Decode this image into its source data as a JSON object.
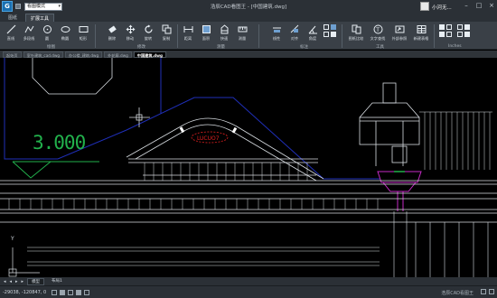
{
  "window": {
    "title": "浩辰CAD看图王 - [中国建筑.dwg]",
    "mode": "看图模式",
    "user_name": "小河无..."
  },
  "ribbon_tabs": [
    "图纸",
    "扩展工具"
  ],
  "ribbon": {
    "group1": {
      "label": "绘图",
      "tools": [
        {
          "label": "直线",
          "icon": "line-icon"
        },
        {
          "label": "多段线",
          "icon": "polyline-icon"
        },
        {
          "label": "圆",
          "icon": "circle-icon"
        },
        {
          "label": "椭圆",
          "icon": "ellipse-icon"
        },
        {
          "label": "矩形",
          "icon": "rectangle-icon"
        }
      ]
    },
    "group2": {
      "label": "修改",
      "tools": [
        {
          "label": "删除",
          "icon": "eraser-icon"
        },
        {
          "label": "移动",
          "icon": "move-icon"
        },
        {
          "label": "旋转",
          "icon": "rotate-icon"
        },
        {
          "label": "复制",
          "icon": "copy-icon"
        }
      ]
    },
    "group3": {
      "label": "测量",
      "tools": [
        {
          "label": "距离",
          "icon": "distance-icon"
        },
        {
          "label": "面积",
          "icon": "area-icon"
        },
        {
          "label": "快速",
          "icon": "quick-measure-icon"
        },
        {
          "label": "测量",
          "icon": "measure-icon"
        }
      ]
    },
    "group4": {
      "label": "标注",
      "tools": [
        {
          "label": "线性",
          "icon": "linear-dim-icon"
        },
        {
          "label": "对齐",
          "icon": "aligned-dim-icon"
        },
        {
          "label": "角度",
          "icon": "angle-dim-icon"
        }
      ]
    },
    "group5": {
      "label": "工具",
      "tools": [
        {
          "label": "图纸比较",
          "icon": "compare-icon"
        },
        {
          "label": "文字查找",
          "icon": "text-search-icon"
        },
        {
          "label": "外部参照",
          "icon": "xref-icon"
        },
        {
          "label": "新建表格",
          "icon": "table-icon"
        }
      ]
    },
    "group6": {
      "label": "Inches"
    }
  },
  "doc_tabs": [
    "起始页",
    "室外建筑_cad.dwg",
    "办公楼_建筑.dwg",
    "外轮廓.dwg",
    "中国建筑.dwg"
  ],
  "active_doc_tab": 4,
  "canvas": {
    "elevation_text": "3.000",
    "section_label": "LUCUO7",
    "axis_y": "Y"
  },
  "layout_tabs": [
    "模型",
    "布局1"
  ],
  "status": {
    "coords": "-29038, -120847, 0",
    "brand": "浩辰CAD看图王"
  },
  "colors": {
    "canvas": "#000000",
    "chrome": "#2b3036",
    "ribbon": "#3a4047",
    "line_white": "#d8dde2",
    "line_blue": "#1f2fb8",
    "line_green": "#22b14c",
    "line_magenta": "#c52ac5",
    "line_red": "#e02020"
  }
}
